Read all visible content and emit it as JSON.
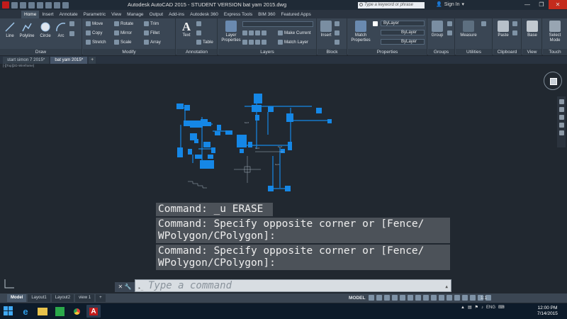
{
  "title_bar": {
    "title": "Autodesk AutoCAD 2015 - STUDENT VERSION     bat yam 2015.dwg",
    "search_placeholder": "Type a keyword or phrase",
    "sign_in": "Sign In"
  },
  "ribbon_tabs": [
    "Home",
    "Insert",
    "Annotate",
    "Parametric",
    "View",
    "Manage",
    "Output",
    "Add-ins",
    "Autodesk 360",
    "Express Tools",
    "BIM 360",
    "Featured Apps"
  ],
  "draw": {
    "line": "Line",
    "polyline": "Polyline",
    "circle": "Circle",
    "arc": "Arc",
    "panel": "Draw"
  },
  "modify": {
    "move": "Move",
    "rotate": "Rotate",
    "trim": "Trim",
    "copy": "Copy",
    "mirror": "Mirror",
    "fillet": "Fillet",
    "stretch": "Stretch",
    "scale": "Scale",
    "array": "Array",
    "panel": "Modify"
  },
  "annotation": {
    "text": "Text",
    "table": "Table",
    "panel": "Annotation"
  },
  "layers": {
    "layer_properties": "Layer Properties",
    "make_current": "Make Current",
    "match_layer": "Match Layer",
    "panel": "Layers"
  },
  "block": {
    "insert": "Insert",
    "panel": "Block"
  },
  "properties": {
    "match_properties": "Match Properties",
    "bylayer1": "ByLayer",
    "bylayer2": "ByLayer",
    "bylayer3": "ByLayer",
    "panel": "Properties"
  },
  "groups": {
    "group": "Group",
    "panel": "Groups"
  },
  "utilities": {
    "measure": "Measure",
    "panel": "Utilities"
  },
  "clipboard": {
    "paste": "Paste",
    "panel": "Clipboard"
  },
  "view": {
    "base": "Base",
    "panel": "View"
  },
  "touch": {
    "select_mode": "Select Mode",
    "panel": "Touch"
  },
  "doc_tabs": [
    "start simon 7 2015*",
    "bat yam 2015*"
  ],
  "viewport_label": "[-][Top][2D Wireframe]",
  "command_history": [
    "Command: _u ERASE",
    "Command: Specify opposite corner or [Fence/\nWPolygon/CPolygon]:",
    "Command: Specify opposite corner or [Fence/\nWPolygon/CPolygon]:"
  ],
  "command_placeholder": "Type a command",
  "layout_tabs": [
    "Model",
    "Layout1",
    "Layout2",
    "view 1"
  ],
  "status": {
    "model": "MODEL",
    "scale": "1:1"
  },
  "tray": {
    "lang": "ENG"
  },
  "clock": {
    "time": "12:00 PM",
    "date": "7/14/2015"
  },
  "colors": {
    "block_blue": "#1587e6",
    "canvas": "#212830",
    "ribbon": "#3a4654",
    "close_red": "#c42b1c"
  }
}
